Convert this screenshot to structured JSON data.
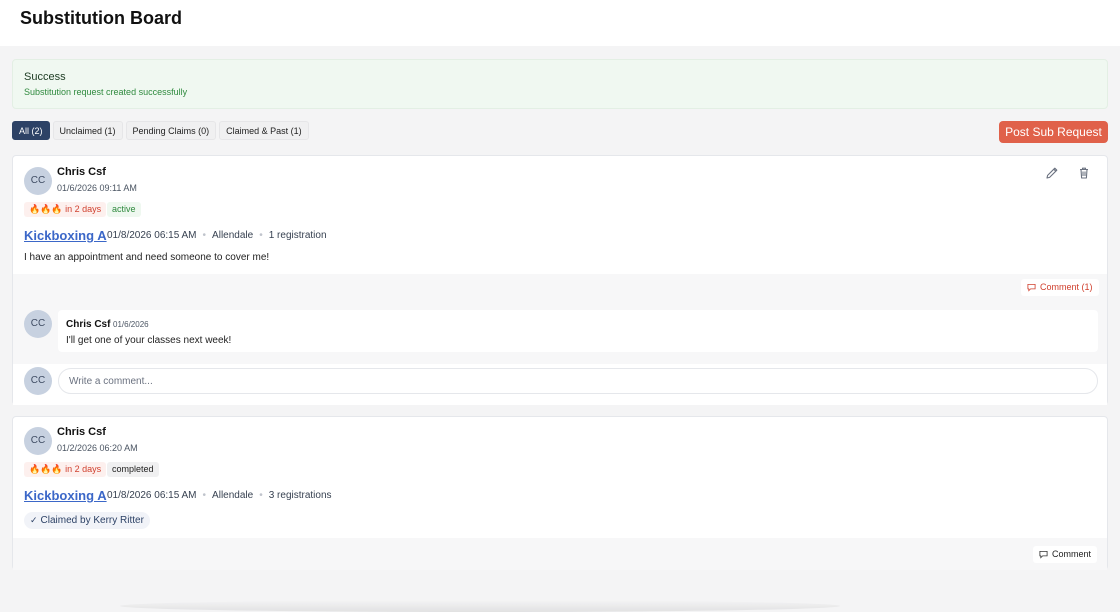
{
  "page": {
    "title": "Substitution Board"
  },
  "alert": {
    "title": "Success",
    "message": "Substitution request created successfully"
  },
  "filters": [
    {
      "label": "All (2)",
      "active": true
    },
    {
      "label": "Unclaimed (1)",
      "active": false
    },
    {
      "label": "Pending Claims (0)",
      "active": false
    },
    {
      "label": "Claimed & Past (1)",
      "active": false
    }
  ],
  "actions": {
    "post_label": "Post Sub Request"
  },
  "colors": {
    "accent": "#e0614a",
    "primary": "#2d4266",
    "link": "#3b67c8",
    "success": "#2f8a3e"
  },
  "posts": [
    {
      "avatar": "CC",
      "author": "Chris Csf",
      "date": "01/6/2026 09:11 AM",
      "urgency": "🔥🔥🔥 in 2 days",
      "status": "active",
      "class_name": "Kickboxing A",
      "class_date": "01/8/2026 06:15 AM",
      "location": "Allendale",
      "registrations": "1 registration",
      "note": "I have an appointment and need someone to cover me!",
      "comment_button": "Comment (1)",
      "comments": [
        {
          "avatar": "CC",
          "author": "Chris Csf",
          "date": "01/6/2026",
          "text": "I'll get one of your classes next week!"
        }
      ],
      "comment_input": {
        "avatar": "CC",
        "placeholder": "Write a comment..."
      }
    },
    {
      "avatar": "CC",
      "author": "Chris Csf",
      "date": "01/2/2026 06:20 AM",
      "urgency": "🔥🔥🔥 in 2 days",
      "status": "completed",
      "class_name": "Kickboxing A",
      "class_date": "01/8/2026 06:15 AM",
      "location": "Allendale",
      "registrations": "3 registrations",
      "claimed_by": "Claimed by Kerry Ritter",
      "comment_button": "Comment"
    }
  ]
}
